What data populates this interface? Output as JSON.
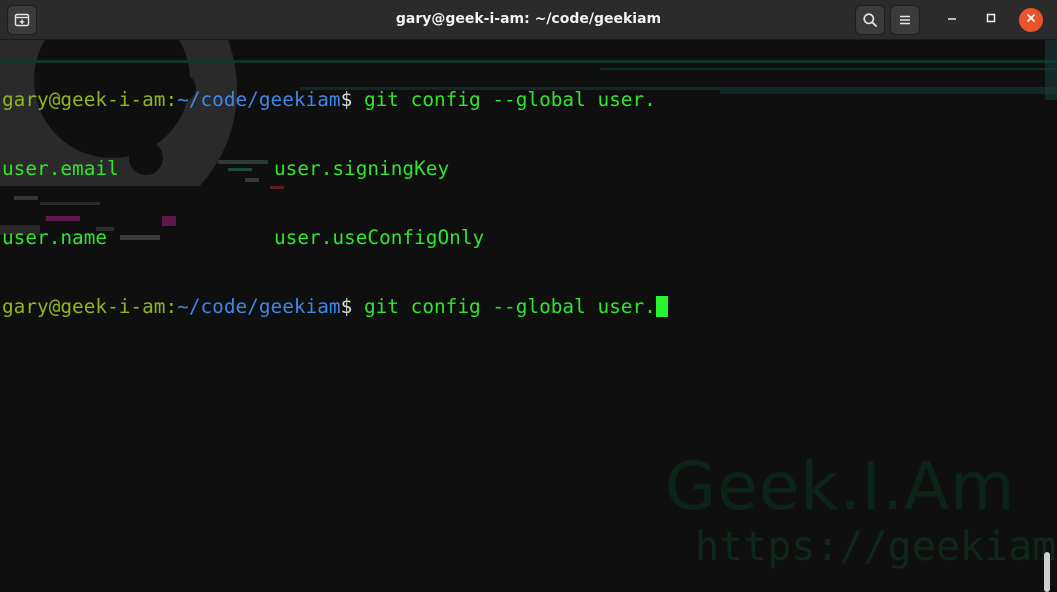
{
  "window": {
    "title": "gary@geek-i-am: ~/code/geekiam"
  },
  "titlebar": {
    "icons": {
      "new_tab": "new-tab-icon",
      "search": "search-icon",
      "menu": "hamburger-menu-icon",
      "minimize": "minimize-icon",
      "maximize": "maximize-icon",
      "close": "close-icon"
    },
    "close_color": "#e9542a"
  },
  "terminal": {
    "colors": {
      "prompt_user": "#8fb520",
      "prompt_path": "#3d87e8",
      "text": "#2fe52f",
      "cursor": "#2af52a",
      "background": "#0f0f0f"
    },
    "line1": {
      "user_host": "gary@geek-i-am",
      "colon": ":",
      "path": "~/code/geekiam",
      "dollar": "$",
      "command": " git config --global user."
    },
    "completions": [
      [
        "user.email",
        "user.signingKey"
      ],
      [
        "user.name",
        "user.useConfigOnly"
      ]
    ],
    "line4": {
      "user_host": "gary@geek-i-am",
      "colon": ":",
      "path": "~/code/geekiam",
      "dollar": "$",
      "command": " git config --global user."
    }
  },
  "wallpaper": {
    "watermark_title": "Geek.I.Am",
    "watermark_url": "https://geekiam.io"
  }
}
